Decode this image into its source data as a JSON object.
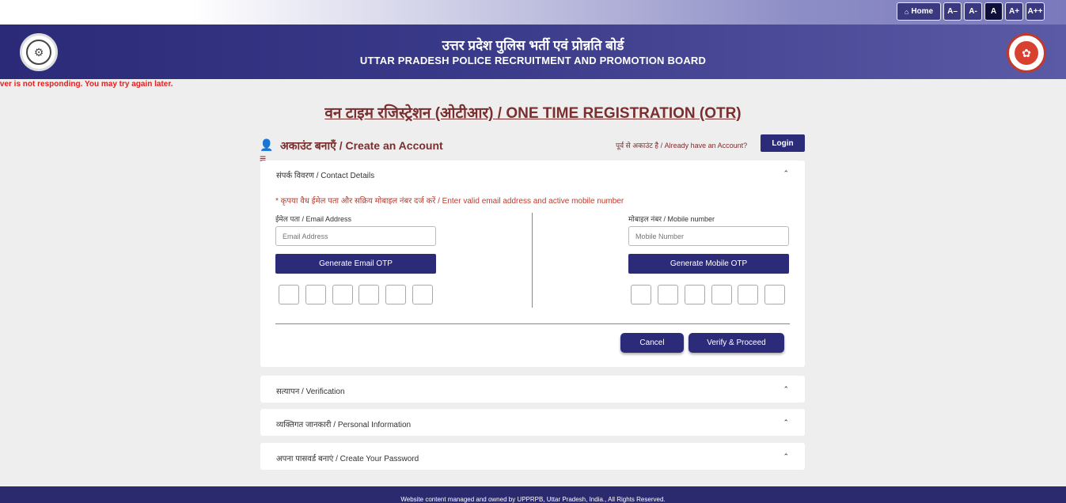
{
  "topbar": {
    "home_label": "Home",
    "font_buttons": [
      "A–",
      "A-",
      "A",
      "A+",
      "A++"
    ]
  },
  "header": {
    "title_hindi": "उत्तर प्रदेश पुलिस भर्ती एवं प्रोन्नति बोर्ड",
    "title_english": "UTTAR PRADESH POLICE RECRUITMENT AND PROMOTION BOARD"
  },
  "error_message": "rver is not responding. You may try again later.",
  "page_heading": "वन टाइम रजिस्ट्रेशन (ओटीआर) / ONE TIME REGISTRATION (OTR)",
  "account": {
    "title": "अकाउंट बनाएँ / Create an Account",
    "already": "पूर्व से अकाउंट है / Already have an Account?",
    "login_label": "Login"
  },
  "contact": {
    "heading": "संपर्क विवरण / Contact Details",
    "note": "* कृपया वैध ईमेल पता और सक्रिय मोबाइल नंबर दर्ज करें / Enter valid email address and active mobile number",
    "email_label": "ईमेल पता / Email Address",
    "email_placeholder": "Email Address",
    "email_otp_label": "Generate Email OTP",
    "mobile_label": "मोबाइल नंबर / Mobile number",
    "mobile_placeholder": "Mobile Number",
    "mobile_otp_label": "Generate Mobile OTP",
    "cancel_label": "Cancel",
    "verify_label": "Verify & Proceed"
  },
  "sections": [
    {
      "label": "सत्यापन / Verification"
    },
    {
      "label": "व्यक्तिगत जानकारी / Personal Information"
    },
    {
      "label": "अपना पासवर्ड बनाएं / Create Your Password"
    }
  ],
  "footer_text": "Website content managed and owned by UPPRPB, Uttar Pradesh, India., All Rights Reserved."
}
